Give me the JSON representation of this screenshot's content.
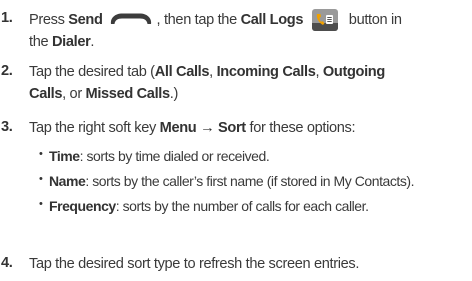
{
  "steps": [
    {
      "number": "1.",
      "l1_a": "Press ",
      "send": "Send",
      "l1_b": ", then tap the ",
      "call_logs": "Call Logs",
      "l1_c": " button in",
      "l2_a": "the ",
      "dialer": "Dialer",
      "l2_b": "."
    },
    {
      "number": "2.",
      "l1_a": "Tap the desired tab (",
      "all": "All Calls",
      "sep1": ", ",
      "incoming": "Incoming Calls",
      "sep2": ", ",
      "outgoing_1": "Outgoing",
      "outgoing_2": "Calls",
      "l2_a": ", or ",
      "missed": "Missed Calls",
      "l2_b": ".)"
    },
    {
      "number": "3.",
      "l1_a": "Tap the right soft key ",
      "menu_sort": "Menu → Sort",
      "l1_b": " for these options:",
      "options": [
        {
          "bullet": "•",
          "term": "Time",
          "desc": ": sorts by time dialed or received."
        },
        {
          "bullet": "•",
          "term": "Name",
          "desc": ": sorts by the caller’s first name (if stored in My Contacts)."
        },
        {
          "bullet": "•",
          "term": "Frequency",
          "desc": ": sorts by the number of calls for each caller."
        }
      ]
    },
    {
      "number": "4.",
      "l1_a": "Tap the desired sort type to refresh the screen entries."
    }
  ],
  "icons": {
    "send": "phone-handset-icon",
    "call_logs": "call-logs-icon"
  },
  "colors": {
    "text": "#3a3a3a",
    "call_logs_icon_bg": "#9a9a9a",
    "call_logs_handset": "#f0a000"
  }
}
